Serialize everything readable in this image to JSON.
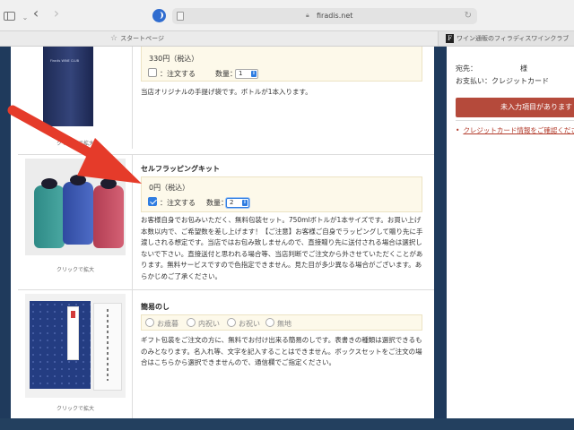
{
  "browser": {
    "url": "firadis.net",
    "favorites": [
      {
        "label": "スタートページ"
      },
      {
        "label": "ワイン通販のフィラディスワインクラブ"
      }
    ]
  },
  "products": [
    {
      "price": "330円（税込）",
      "order_label": "：注文する",
      "qty_label": "数量：",
      "qty_value": "1",
      "description": "当店オリジナルの手提げ袋です。ボトルが1本入ります。",
      "image_caption": "クリックで拡大",
      "checked": false
    },
    {
      "name": "セルフラッピングキット",
      "price": "0円（税込）",
      "order_label": "：注文する",
      "qty_label": "数量：",
      "qty_value": "2",
      "description": "お客様自身でお包みいただく、無料包装セット。750mlボトルが1本サイズです。お買い上げ本数以内で、ご希望数を差し上げます！【ご注意】お客様ご自身でラッピングして贈り先に手渡しされる想定です。当店ではお包み致しませんので、直接贈り先に送付される場合は選択しないで下さい。直接送付と思われる場合等、当店判断でご注文から外させていただくことがあります。無料サービスですので色指定できません。見た目が多少異なる場合がございます。あらかじめご了承ください。",
      "image_caption": "クリックで拡大",
      "checked": true
    },
    {
      "name": "簡易のし",
      "options": [
        "お歳暮",
        "内祝い",
        "お祝い",
        "無地"
      ],
      "description": "ギフト包装をご注文の方に、無料でお付け出来る簡易のしです。表書きの種類は選択できるものみとなります。名入れ等、文字を記入することはできません。ボックスセットをご注文の場合はこちらから選択できませんので、通信欄でご指定ください。",
      "image_caption": "クリックで拡大"
    }
  ],
  "sidebar": {
    "recipient_label": "宛先：",
    "recipient_suffix": "様",
    "payment_label": "お支払い：クレジットカード",
    "button_label": "未入力項目があります",
    "link_label": "クレジットカード情報をご確認ください"
  },
  "colors": {
    "accent": "#2f7de1",
    "button": "#b54a3b",
    "arrow": "#e53b2a",
    "background": "#1f3a5c"
  }
}
